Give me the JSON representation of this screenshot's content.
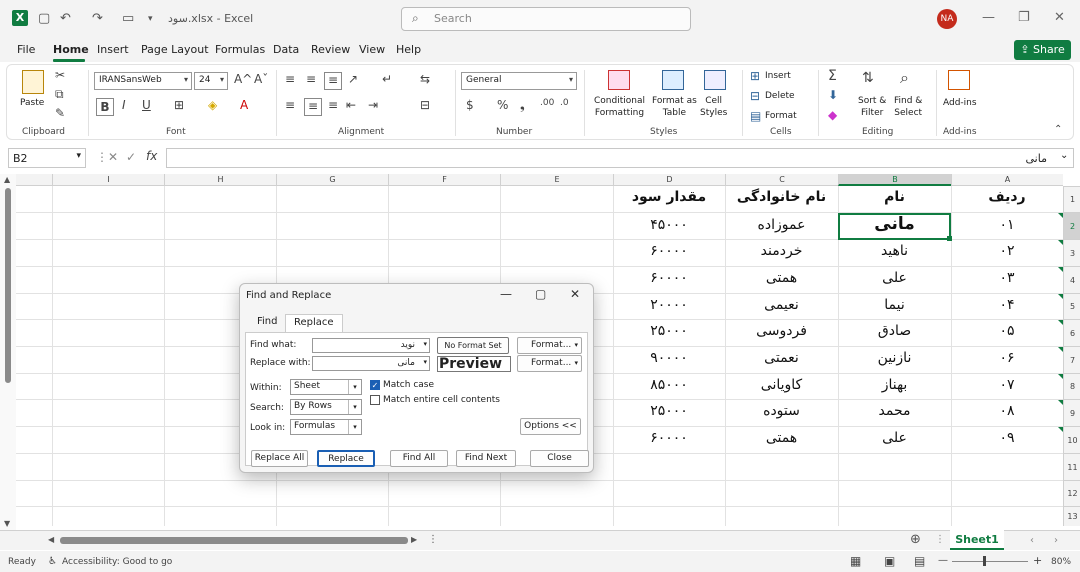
{
  "window": {
    "title": "سود.xlsx - Excel",
    "search_placeholder": "Search",
    "user_initials": "NA"
  },
  "menu": [
    "File",
    "Home",
    "Insert",
    "Page Layout",
    "Formulas",
    "Data",
    "Review",
    "View",
    "Help"
  ],
  "share_label": "Share",
  "ribbon": {
    "clipboard": {
      "paste": "Paste",
      "group": "Clipboard"
    },
    "font": {
      "name": "IRANSansWeb",
      "size": "24",
      "group": "Font"
    },
    "alignment": {
      "group": "Alignment"
    },
    "number": {
      "format": "General",
      "group": "Number"
    },
    "styles": {
      "conditional": "Conditional",
      "conditional2": "Formatting",
      "format_as": "Format as",
      "format_as2": "Table",
      "cell": "Cell",
      "cell2": "Styles",
      "group": "Styles"
    },
    "cells": {
      "insert": "Insert",
      "delete": "Delete",
      "format": "Format",
      "group": "Cells"
    },
    "editing": {
      "sort": "Sort &",
      "sort2": "Filter",
      "find": "Find &",
      "find2": "Select",
      "group": "Editing"
    },
    "addins": {
      "label": "Add-ins",
      "group": "Add-ins"
    }
  },
  "formula_bar": {
    "cell_ref": "B2",
    "value": "مانی"
  },
  "columns": [
    "I",
    "H",
    "G",
    "F",
    "E",
    "D",
    "C",
    "B",
    "A"
  ],
  "rows": [
    "1",
    "2",
    "3",
    "4",
    "5",
    "6",
    "7",
    "8",
    "9",
    "10",
    "11",
    "12",
    "13"
  ],
  "table": {
    "headers": {
      "A": "ردیف",
      "B": "نام",
      "C": "نام خانوادگی",
      "D": "مقدار سود"
    },
    "rows": [
      {
        "A": "۰۱",
        "B": "مانی",
        "C": "عموزاده",
        "D": "۴۵۰۰۰"
      },
      {
        "A": "۰۲",
        "B": "ناهید",
        "C": "خردمند",
        "D": "۶۰۰۰۰"
      },
      {
        "A": "۰۳",
        "B": "علی",
        "C": "همتی",
        "D": "۶۰۰۰۰"
      },
      {
        "A": "۰۴",
        "B": "نیما",
        "C": "نعیمی",
        "D": "۲۰۰۰۰"
      },
      {
        "A": "۰۵",
        "B": "صادق",
        "C": "فردوسی",
        "D": "۲۵۰۰۰"
      },
      {
        "A": "۰۶",
        "B": "نازنین",
        "C": "نعمتی",
        "D": "۹۰۰۰۰"
      },
      {
        "A": "۰۷",
        "B": "بهناز",
        "C": "کاویانی",
        "D": "۸۵۰۰۰"
      },
      {
        "A": "۰۸",
        "B": "محمد",
        "C": "ستوده",
        "D": "۲۵۰۰۰"
      },
      {
        "A": "۰۹",
        "B": "علی",
        "C": "همتی",
        "D": "۶۰۰۰۰"
      }
    ]
  },
  "dialog": {
    "title": "Find and Replace",
    "tabs": [
      "Find",
      "Replace"
    ],
    "find_what_label": "Find what:",
    "find_what_value": "نوید",
    "replace_with_label": "Replace with:",
    "replace_with_value": "مانی",
    "no_format": "No Format Set",
    "preview": "Preview",
    "format_btn": "Format...",
    "within_label": "Within:",
    "within_value": "Sheet",
    "search_label": "Search:",
    "search_value": "By Rows",
    "lookin_label": "Look in:",
    "lookin_value": "Formulas",
    "match_case": "Match case",
    "match_entire": "Match entire cell contents",
    "options": "Options <<",
    "replace_all": "Replace All",
    "replace": "Replace",
    "find_all": "Find All",
    "find_next": "Find Next",
    "close": "Close"
  },
  "sheet_tab": "Sheet1",
  "status": {
    "ready": "Ready",
    "accessibility": "Accessibility: Good to go",
    "zoom": "80%"
  }
}
